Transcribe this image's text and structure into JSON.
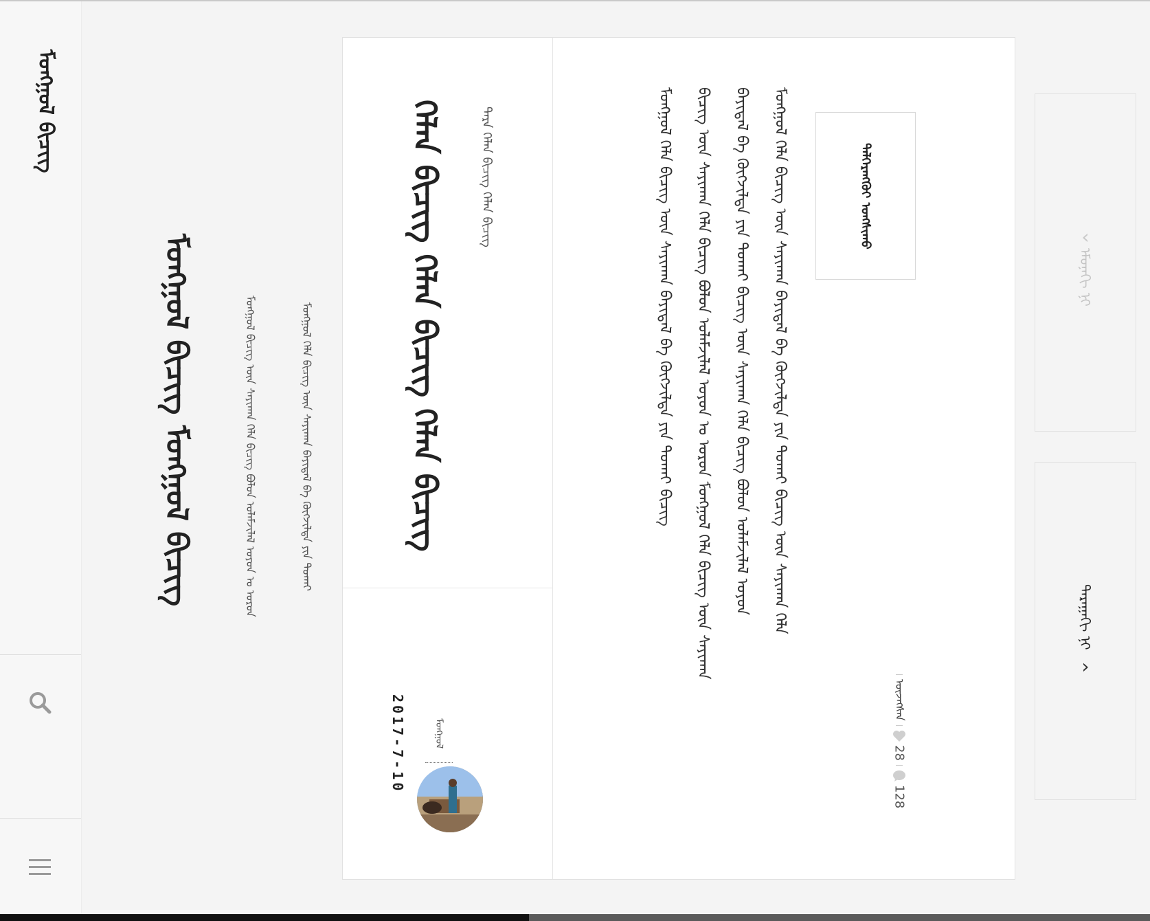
{
  "sidebar": {
    "logo": "ᠮᠣᠩᠭᠣᠯ ᠪᠢᠴᠢᠭ",
    "search_icon": "search-icon",
    "menu_icon": "menu-icon"
  },
  "blog": {
    "title": "ᠮᠣᠩᠭᠣᠯ ᠪᠢᠴᠢᠭ ᠮᠣᠩᠭᠣᠯ ᠪᠢᠴᠢᠭ",
    "subtitle_1": "ᠮᠣᠩᠭᠣᠯ ᠪᠢᠴᠢᠭ᠌ ᠦᠨ ᠰᠠᠶᠢᠬᠠᠨ ᠬᠡᠯᠡ ᠪᠢᠴᠢᠭ ᠪᠣᠯᠤᠨ ᠤᠯᠠᠮᠵᠢᠯᠠᠯ ᠣᠶᠤᠨ ᠤ ᠣᠷᠤᠨ",
    "subtitle_2": "ᠮᠣᠩᠭᠣᠯ ᠬᠡᠯᠡ ᠪᠢᠴᠢᠭ ᠦᠨ ᠰᠠᠶᠢᠬᠠᠨ ᠪᠠᠶᠢᠳᠠᠯ ᠪᠠ ᠬᠥᠭᠵᠢᠯᠲᠡ ᠶᠢᠨ ᠲᠤᠬᠠᠢ"
  },
  "post": {
    "title": "ᠬᠡᠯᠡᠨ ᠪᠢᠴᠢᠭ ᠬᠡᠯᠡᠨ ᠪᠢᠴᠢᠭ ᠬᠡᠯᠡᠨ ᠪᠢᠴᠢᠭ",
    "category": "ᠲᠡᠷᠡ ᠬᠡᠯᠡᠨ ᠪᠢᠴᠢᠭ ᠬᠡᠯᠡᠨ ᠪᠢᠴᠢᠭ",
    "author": "ᠮᠣᠩᠭᠣᠯ",
    "date": "2017-7-10",
    "excerpt": [
      "ᠮᠣᠩᠭᠣᠯ ᠬᠡᠯᠡ ᠪᠢᠴᠢᠭ ᠦᠨ ᠰᠠᠶᠢᠬᠠᠨ ᠪᠠᠶᠢᠳᠠᠯ ᠪᠠ ᠬᠥᠭᠵᠢᠯᠲᠡ ᠶᠢᠨ ᠲᠤᠬᠠᠢ ᠪᠢᠴᠢᠭ",
      "ᠪᠢᠴᠢᠭ ᠦᠨ ᠰᠠᠶᠢᠬᠠᠨ ᠬᠡᠯᠡ ᠪᠢᠴᠢᠭ ᠪᠣᠯᠤᠨ ᠤᠯᠠᠮᠵᠢᠯᠠᠯ ᠣᠶᠤᠨ ᠤ ᠣᠷᠤᠨ ᠮᠣᠩᠭᠣᠯ ᠬᠡᠯᠡ ᠪᠢᠴᠢᠭ ᠦᠨ ᠰᠠᠶᠢᠬᠠᠨ",
      "ᠪᠠᠶᠢᠳᠠᠯ ᠪᠠ ᠬᠥᠭᠵᠢᠯᠲᠡ ᠶᠢᠨ ᠲᠤᠬᠠᠢ ᠪᠢᠴᠢᠭ ᠦᠨ ᠰᠠᠶᠢᠬᠠᠨ ᠬᠡᠯᠡ ᠪᠢᠴᠢᠭ ᠪᠣᠯᠤᠨ ᠤᠯᠠᠮᠵᠢᠯᠠᠯ ᠣᠶᠤᠨ",
      "ᠮᠣᠩᠭᠣᠯ ᠬᠡᠯᠡ ᠪᠢᠴᠢᠭ ᠦᠨ ᠰᠠᠶᠢᠬᠠᠨ ᠪᠠᠶᠢᠳᠠᠯ ᠪᠠ ᠬᠥᠭᠵᠢᠯᠲᠡ ᠶᠢᠨ ᠲᠤᠬᠠᠢ ᠪᠢᠴᠢᠭ ᠦᠨ ᠰᠠᠶᠢᠬᠠᠨ ᠬᠡᠯᠡ"
    ],
    "read_more": "ᠳᠡᠯᠭᠡᠷᠡᠩᠭᠦᠢ ᠤᠩᠰᠢᠬᠤ",
    "views_label": "ᠦᠵᠡᠭᠰᠡᠨ",
    "likes": "28",
    "comments": "128",
    "like_icon": "heart-icon",
    "comment_icon": "comment-icon"
  },
  "pager": {
    "prev_label": "ᠡᠮᠦᠨᠡᠬᠢ ᠨᠢ",
    "next_label": "ᠳᠠᠷᠠᠭᠠᠬᠢ ᠨᠢ"
  },
  "colors": {
    "background": "#f4f4f4",
    "card": "#ffffff",
    "text": "#222222",
    "muted": "#c4c4c4"
  }
}
